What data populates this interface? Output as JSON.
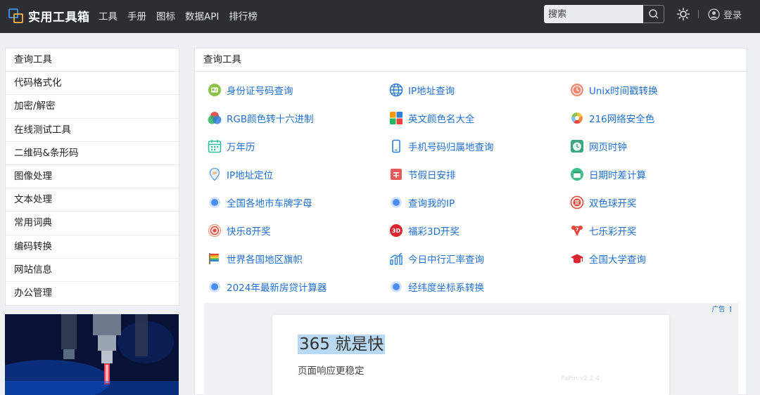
{
  "header": {
    "app_title": "实用工具箱",
    "nav": [
      "工具",
      "手册",
      "图标",
      "数据API",
      "排行榜"
    ],
    "search_placeholder": "搜索",
    "login_label": "登录"
  },
  "sidebar": {
    "items": [
      "查询工具",
      "代码格式化",
      "加密/解密",
      "在线测试工具",
      "二维码&条形码",
      "图像处理",
      "文本处理",
      "常用词典",
      "编码转换",
      "网站信息",
      "办公管理"
    ]
  },
  "panel": {
    "title": "查询工具",
    "tools": [
      {
        "label": "身份证号码查询",
        "icon": "id-card-icon"
      },
      {
        "label": "IP地址查询",
        "icon": "globe-icon"
      },
      {
        "label": "Unix时间戳转换",
        "icon": "clock-icon"
      },
      {
        "label": "RGB颜色转十六进制",
        "icon": "rgb-circles-icon"
      },
      {
        "label": "英文颜色名大全",
        "icon": "color-grid-icon"
      },
      {
        "label": "216网络安全色",
        "icon": "color-wheel-icon"
      },
      {
        "label": "万年历",
        "icon": "calendar-icon"
      },
      {
        "label": "手机号码归属地查询",
        "icon": "phone-icon"
      },
      {
        "label": "网页时钟",
        "icon": "web-clock-icon"
      },
      {
        "label": "IP地址定位",
        "icon": "location-pin-icon"
      },
      {
        "label": "节假日安排",
        "icon": "holiday-icon"
      },
      {
        "label": "日期时差计算",
        "icon": "date-diff-icon"
      },
      {
        "label": "全国各地市车牌字母",
        "icon": "dot-icon"
      },
      {
        "label": "查询我的IP",
        "icon": "dot-icon"
      },
      {
        "label": "双色球开奖",
        "icon": "lottery-ball-icon"
      },
      {
        "label": "快乐8开奖",
        "icon": "target-icon"
      },
      {
        "label": "福彩3D开奖",
        "icon": "3d-lottery-icon"
      },
      {
        "label": "七乐彩开奖",
        "icon": "seven-lottery-icon"
      },
      {
        "label": "世界各国地区旗帜",
        "icon": "flag-icon"
      },
      {
        "label": "今日中行汇率查询",
        "icon": "bar-chart-icon"
      },
      {
        "label": "全国大学查询",
        "icon": "graduation-cap-icon"
      },
      {
        "label": "2024年最新房贷计算器",
        "icon": "dot-icon"
      },
      {
        "label": "经纬度坐标系转换",
        "icon": "dot-icon"
      }
    ],
    "ad": {
      "tag": "广告",
      "headline": "365 就是快",
      "subline": "页面响应更稳定",
      "watermark": "PaPin v2.2.4"
    }
  },
  "colors": {
    "topbar": "#2b2e33",
    "link": "#1f6fd1",
    "accent_orange": "#e6a23c",
    "accent_blue": "#3d8bd6"
  }
}
